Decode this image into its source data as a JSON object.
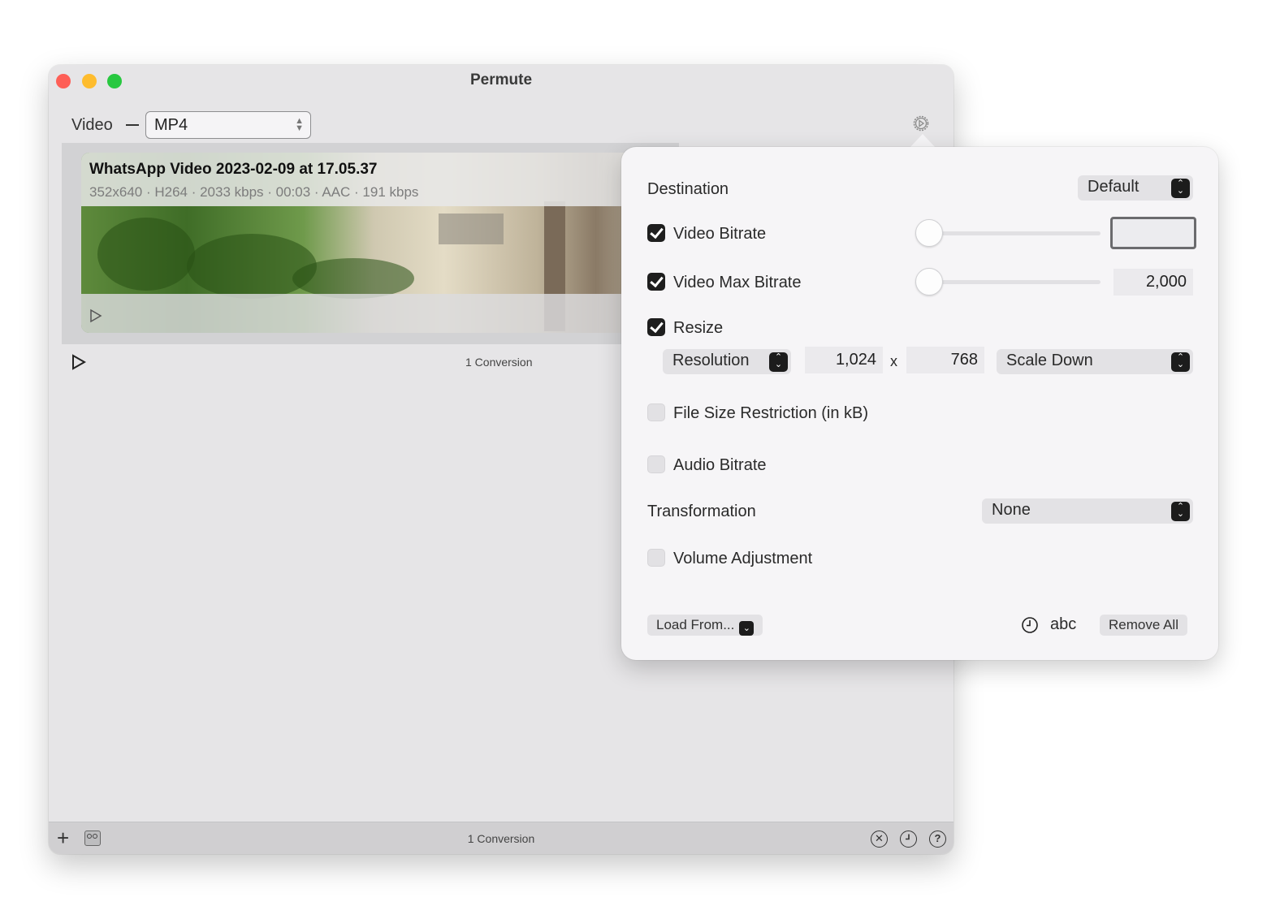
{
  "window": {
    "title": "Permute",
    "traffic_lights": [
      "close",
      "minimize",
      "zoom"
    ]
  },
  "toolbar": {
    "type_label": "Video",
    "format_select": "MP4",
    "settings_icon": "gear-play-icon"
  },
  "video_item": {
    "name": "WhatsApp Video 2023-02-09 at 17.05.37",
    "meta": "352x640 · H264 · 2033 kbps · 00:03 · AAC · 191 kbps",
    "play_icon": "play-icon"
  },
  "list_footer": {
    "conversion_count": "1 Conversion"
  },
  "bottom_bar": {
    "add_icon": "plus-icon",
    "recorder_icon": "cassette-icon",
    "conversion_count": "1 Conversion",
    "icons": [
      "cancel-icon",
      "history-icon",
      "help-icon"
    ]
  },
  "popover": {
    "destination": {
      "label": "Destination",
      "value": "Default"
    },
    "video_bitrate": {
      "label": "Video Bitrate",
      "checked": true,
      "value": "",
      "slider": 0.0
    },
    "video_max_bitrate": {
      "label": "Video Max Bitrate",
      "checked": true,
      "value": "2,000",
      "slider": 0.0
    },
    "resize": {
      "label": "Resize",
      "checked": true,
      "mode": "Resolution",
      "width": "1,024",
      "separator": "x",
      "height": "768",
      "scaling": "Scale Down"
    },
    "file_size": {
      "label": "File Size Restriction (in kB)",
      "checked": false
    },
    "audio_bitrate": {
      "label": "Audio Bitrate",
      "checked": false
    },
    "transformation": {
      "label": "Transformation",
      "value": "None"
    },
    "volume": {
      "label": "Volume Adjustment",
      "checked": false
    },
    "footer": {
      "load_from": "Load From...",
      "clock_icon": "clock-icon",
      "abc": "abc",
      "remove_all": "Remove All"
    }
  }
}
